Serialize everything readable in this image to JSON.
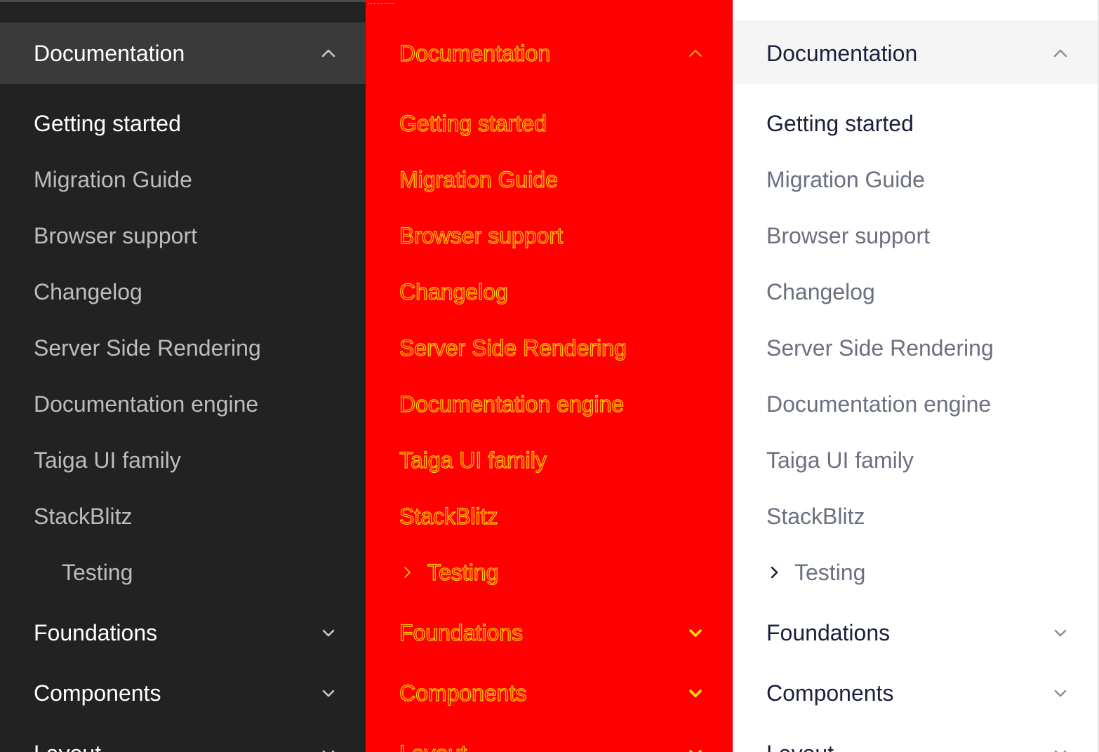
{
  "nav": {
    "open_group": "Documentation",
    "items": [
      "Getting started",
      "Migration Guide",
      "Browser support",
      "Changelog",
      "Server Side Rendering",
      "Documentation engine",
      "Taiga UI family",
      "StackBlitz"
    ],
    "testing": "Testing",
    "groups_collapsed": [
      "Foundations",
      "Components",
      "Layout"
    ]
  },
  "themes": {
    "dark": {
      "background": "#222222",
      "active_text": "#ffffff",
      "text": "#bdbdbd"
    },
    "red": {
      "background": "#ff0000",
      "outline": "#ffd400"
    },
    "light": {
      "background": "#ffffff",
      "active_text": "#1b1f3b",
      "text": "#6b6f80"
    }
  },
  "icons": {
    "expanded": "chevron-up-icon",
    "collapsed": "chevron-down-icon",
    "submenu": "chevron-right-icon"
  }
}
